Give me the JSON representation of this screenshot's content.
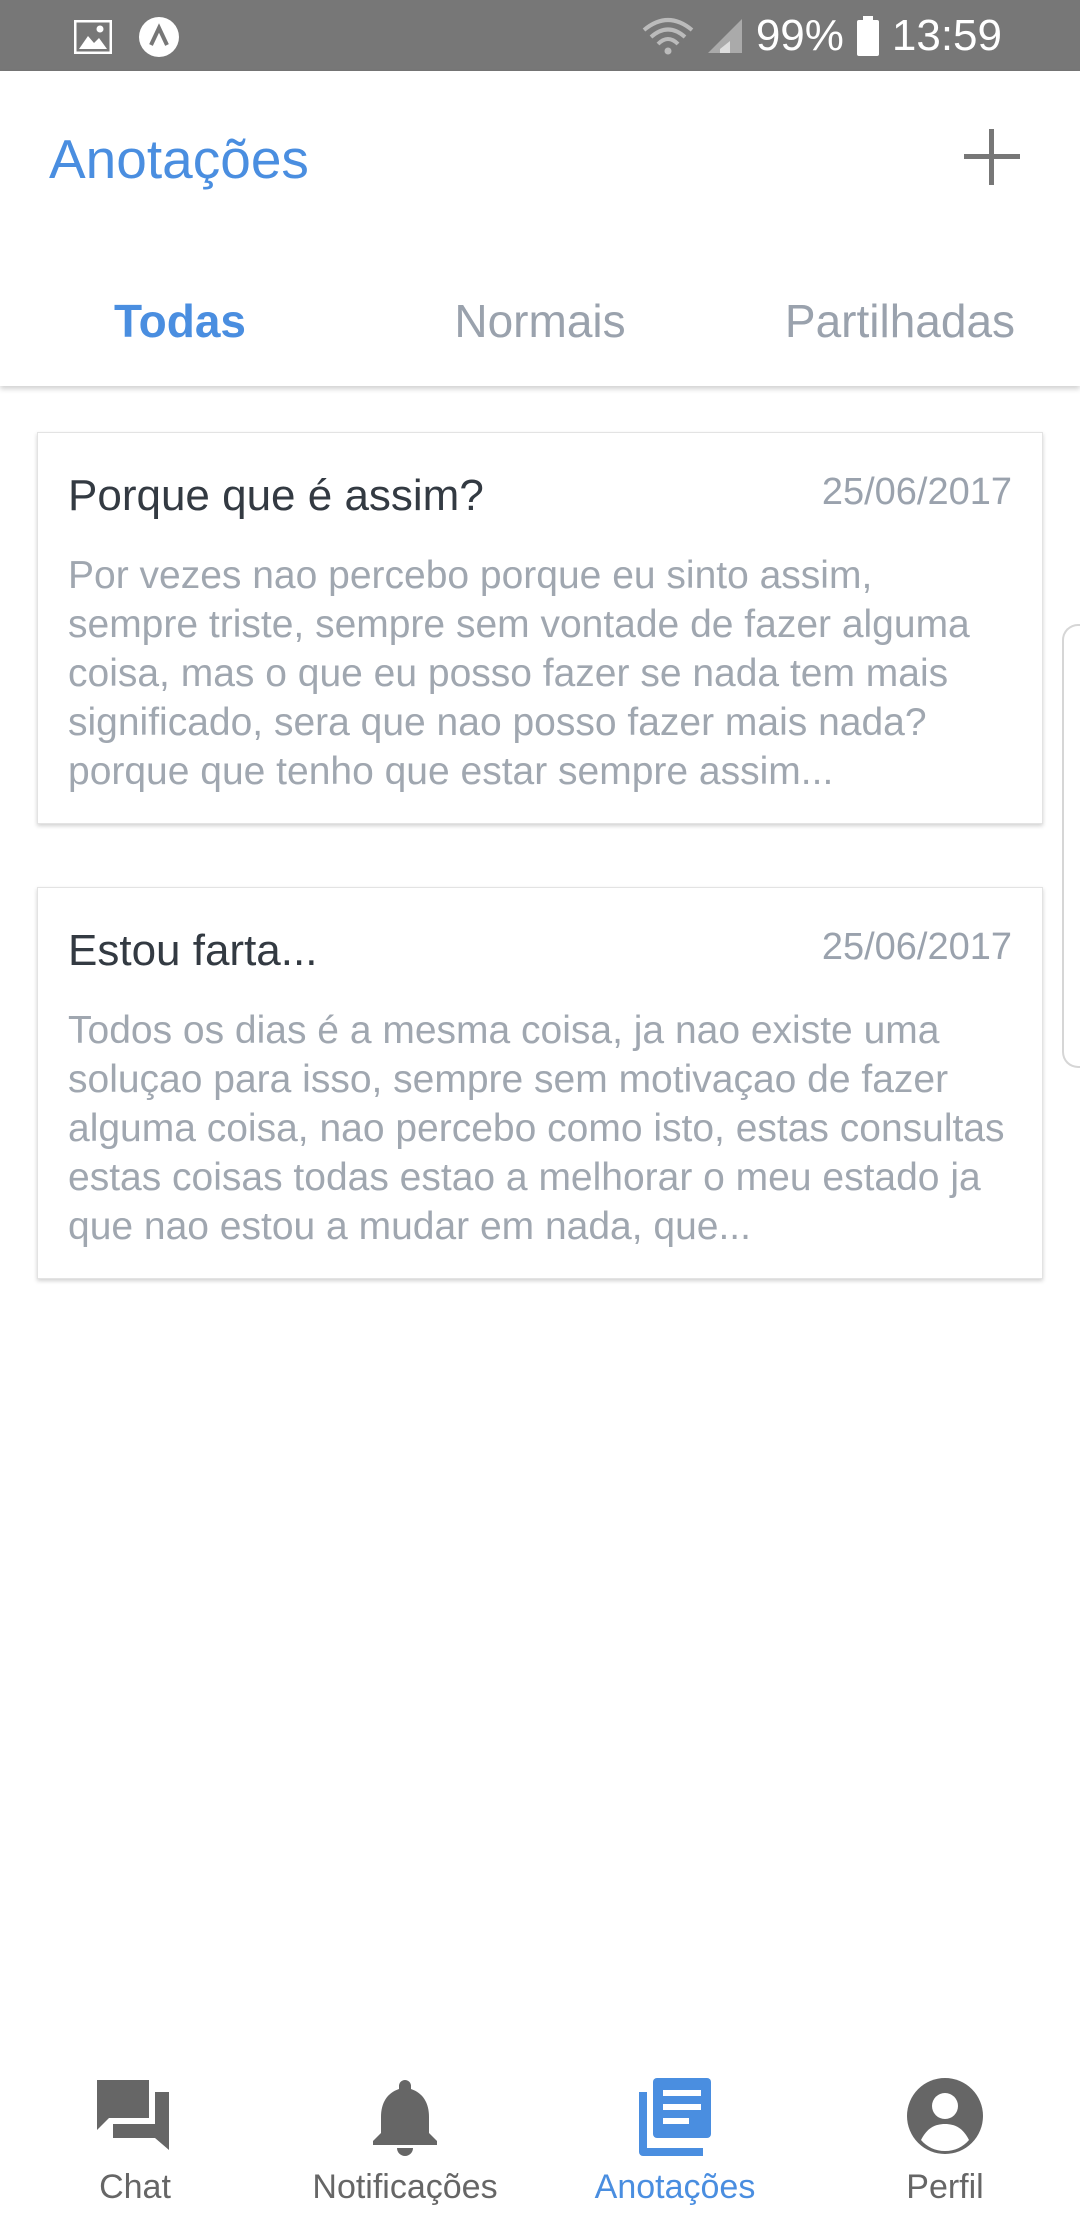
{
  "status_bar": {
    "battery": "99%",
    "time": "13:59"
  },
  "header": {
    "title": "Anotações"
  },
  "tabs": [
    {
      "label": "Todas",
      "active": true
    },
    {
      "label": "Normais",
      "active": false
    },
    {
      "label": "Partilhadas",
      "active": false
    }
  ],
  "notes": [
    {
      "title": "Porque que é assim?",
      "date": "25/06/2017",
      "body": "Por vezes nao percebo porque eu sinto assim, sempre triste, sempre sem vontade de fazer alguma coisa, mas o que eu posso fazer se nada tem mais significado, sera que nao posso fazer mais nada? porque que tenho que estar sempre assim..."
    },
    {
      "title": "Estou farta...",
      "date": "25/06/2017",
      "body": "Todos os dias é a mesma coisa, ja nao existe uma soluçao para isso, sempre sem motivaçao de fazer alguma coisa, nao percebo como isto, estas consultas estas coisas todas estao a melhorar o meu estado ja que nao estou a mudar em nada, que..."
    }
  ],
  "bottom_nav": [
    {
      "label": "Chat",
      "icon": "chat-icon"
    },
    {
      "label": "Notificações",
      "icon": "bell-icon"
    },
    {
      "label": "Anotações",
      "icon": "notes-icon",
      "active": true
    },
    {
      "label": "Perfil",
      "icon": "profile-icon"
    }
  ],
  "colors": {
    "accent": "#4a8ee0",
    "statusbar": "#777777",
    "inactive_tab": "#9aa2ad",
    "nav_icon": "#666666"
  }
}
